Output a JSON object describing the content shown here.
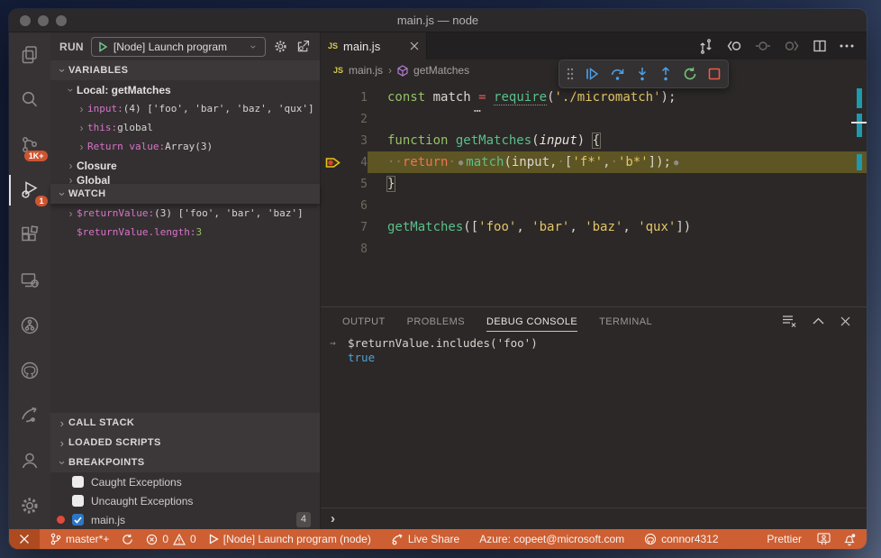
{
  "titlebar": {
    "title": "main.js — node"
  },
  "activity_bar": {
    "badges": {
      "source_control": "1K+",
      "debug": "1"
    }
  },
  "sidebar": {
    "run": {
      "label": "RUN",
      "config": "[Node] Launch program"
    },
    "sections": {
      "variables": "VARIABLES",
      "watch": "WATCH",
      "call_stack": "CALL STACK",
      "loaded_scripts": "LOADED SCRIPTS",
      "breakpoints": "BREAKPOINTS"
    },
    "variables": {
      "rows": [
        {
          "indent": 1,
          "chevron": "down",
          "cls": "scope",
          "parts": [
            {
              "t": "Local: getMatches",
              "c": "scope"
            }
          ]
        },
        {
          "indent": 2,
          "chevron": "right",
          "parts": [
            {
              "t": "input:",
              "c": "key"
            },
            {
              "t": " (4) ['foo', 'bar', 'baz', 'qux']",
              "c": "val"
            }
          ]
        },
        {
          "indent": 2,
          "chevron": "right",
          "parts": [
            {
              "t": "this:",
              "c": "key"
            },
            {
              "t": " global",
              "c": "val"
            }
          ]
        },
        {
          "indent": 2,
          "chevron": "right",
          "parts": [
            {
              "t": "Return value:",
              "c": "key"
            },
            {
              "t": " Array(3)",
              "c": "val"
            }
          ]
        },
        {
          "indent": 1,
          "chevron": "right",
          "cls": "scope",
          "parts": [
            {
              "t": "Closure",
              "c": "scope"
            }
          ]
        },
        {
          "indent": 1,
          "chevron": "right",
          "cls": "scope clipped",
          "parts": [
            {
              "t": "Global",
              "c": "scope"
            }
          ]
        }
      ]
    },
    "watch": {
      "rows": [
        {
          "indent": 1,
          "chevron": "right",
          "parts": [
            {
              "t": "$returnValue:",
              "c": "key"
            },
            {
              "t": " (3) ['foo', 'bar', 'baz']",
              "c": "val"
            }
          ]
        },
        {
          "indent": 1,
          "chevron": null,
          "parts": [
            {
              "t": "$returnValue.length:",
              "c": "key"
            },
            {
              "t": " ",
              "c": "val"
            },
            {
              "t": "3",
              "c": "green"
            }
          ]
        }
      ]
    },
    "breakpoints": {
      "rows": [
        {
          "checkbox": "unchecked",
          "label": "Caught Exceptions"
        },
        {
          "checkbox": "unchecked",
          "label": "Uncaught Exceptions"
        },
        {
          "dot": true,
          "checkbox": "checked",
          "label": "main.js",
          "badge": "4"
        }
      ]
    }
  },
  "editor": {
    "tab": {
      "icon_label": "JS",
      "label": "main.js"
    },
    "breadcrumb": {
      "file_icon": "JS",
      "file": "main.js",
      "symbol": "getMatches"
    },
    "code": {
      "hint_dots": "…",
      "lines": [
        {
          "num": "1",
          "hint": true,
          "tokens": [
            {
              "t": "const",
              "c": "kw"
            },
            {
              "t": " match ",
              "c": "txt"
            },
            {
              "t": "=",
              "c": "op"
            },
            {
              "t": " ",
              "c": "txt"
            },
            {
              "t": "require",
              "c": "fn dotted"
            },
            {
              "t": "(",
              "c": "txt"
            },
            {
              "t": "'./micromatch'",
              "c": "str"
            },
            {
              "t": ");",
              "c": "txt"
            }
          ]
        },
        {
          "num": "2",
          "tokens": []
        },
        {
          "num": "3",
          "tokens": [
            {
              "t": "function",
              "c": "kw"
            },
            {
              "t": " ",
              "c": "txt"
            },
            {
              "t": "getMatches",
              "c": "fn"
            },
            {
              "t": "(",
              "c": "txt"
            },
            {
              "t": "input",
              "c": "param"
            },
            {
              "t": ") ",
              "c": "txt"
            },
            {
              "t": "{",
              "c": "txt brkt"
            }
          ]
        },
        {
          "num": "4",
          "current": true,
          "tokens": [
            {
              "t": "··",
              "c": "ws"
            },
            {
              "t": "return",
              "c": "ret"
            },
            {
              "t": "·",
              "c": "ws"
            },
            {
              "t": "●",
              "c": "idot"
            },
            {
              "t": "match",
              "c": "fn"
            },
            {
              "t": "(input,",
              "c": "txt"
            },
            {
              "t": "·",
              "c": "ws"
            },
            {
              "t": "[",
              "c": "txt"
            },
            {
              "t": "'f*'",
              "c": "str"
            },
            {
              "t": ",",
              "c": "txt"
            },
            {
              "t": "·",
              "c": "ws"
            },
            {
              "t": "'b*'",
              "c": "str"
            },
            {
              "t": "]);",
              "c": "txt"
            },
            {
              "t": "●",
              "c": "idot"
            }
          ]
        },
        {
          "num": "5",
          "tokens": [
            {
              "t": "}",
              "c": "txt brkt"
            }
          ]
        },
        {
          "num": "6",
          "tokens": []
        },
        {
          "num": "7",
          "tokens": [
            {
              "t": "getMatches",
              "c": "fn"
            },
            {
              "t": "([",
              "c": "txt"
            },
            {
              "t": "'foo'",
              "c": "str"
            },
            {
              "t": ", ",
              "c": "txt"
            },
            {
              "t": "'bar'",
              "c": "str"
            },
            {
              "t": ", ",
              "c": "txt"
            },
            {
              "t": "'baz'",
              "c": "str"
            },
            {
              "t": ", ",
              "c": "txt"
            },
            {
              "t": "'qux'",
              "c": "str"
            },
            {
              "t": "])",
              "c": "txt"
            }
          ]
        },
        {
          "num": "8",
          "tokens": []
        }
      ]
    }
  },
  "panel": {
    "tabs": [
      {
        "label": "OUTPUT"
      },
      {
        "label": "PROBLEMS"
      },
      {
        "label": "DEBUG CONSOLE",
        "active": true
      },
      {
        "label": "TERMINAL"
      }
    ],
    "console": {
      "arrow": "→",
      "prompt": "›",
      "lines": [
        {
          "prefix": "arrow",
          "parts": [
            {
              "t": "$returnValue.includes('foo')",
              "c": "ctxt"
            }
          ]
        },
        {
          "parts": [
            {
              "t": "true",
              "c": "blue"
            }
          ]
        }
      ]
    }
  },
  "statusbar": {
    "branch": "master*+",
    "errors": "0",
    "warnings": "0",
    "launch": "[Node] Launch program (node)",
    "live_share": "Live Share",
    "azure": "Azure: copeet@microsoft.com",
    "account": "connor4312",
    "prettier": "Prettier"
  }
}
